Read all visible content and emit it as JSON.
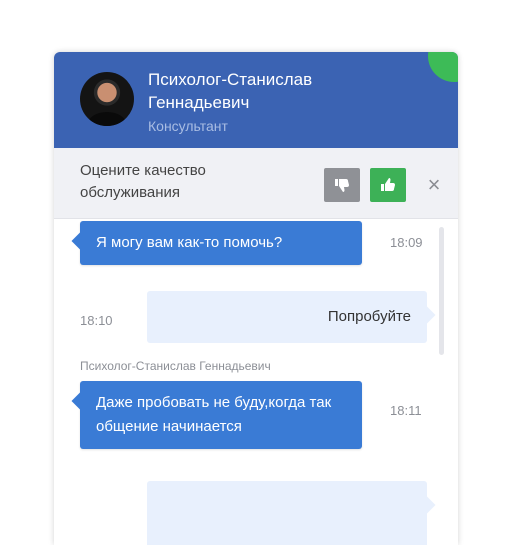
{
  "header": {
    "agent_name": "Психолог-Станислав Геннадьевич",
    "agent_role": "Консультант",
    "avatar_icon": "user-photo"
  },
  "rating": {
    "prompt": "Оцените качество обслуживания",
    "dislike_icon": "thumbs-down-icon",
    "like_icon": "thumbs-up-icon",
    "close_icon": "close-icon",
    "close_glyph": "×"
  },
  "messages": [
    {
      "direction": "in",
      "text": "Я могу вам как-то помочь?",
      "time": "18:09"
    },
    {
      "direction": "out",
      "text": "Попробуйте",
      "time": "18:10"
    },
    {
      "direction": "in",
      "sender": "Психолог-Станислав Геннадьевич",
      "text": "Даже пробовать не буду,когда так общение начинается",
      "time": "18:11"
    },
    {
      "direction": "out",
      "text": "",
      "time": ""
    }
  ],
  "colors": {
    "header": "#3b63b3",
    "incoming_bubble": "#3a7bd5",
    "outgoing_bubble": "#e8f0fd",
    "like": "#3db157",
    "dislike": "#8f9196",
    "online": "#3dbb57"
  }
}
